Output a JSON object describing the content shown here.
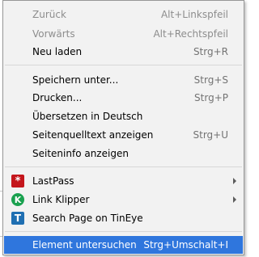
{
  "menu": {
    "back": {
      "label": "Zurück",
      "shortcut": "Alt+Linkspfeil"
    },
    "forward": {
      "label": "Vorwärts",
      "shortcut": "Alt+Rechtspfeil"
    },
    "reload": {
      "label": "Neu laden",
      "shortcut": "Strg+R"
    },
    "save_as": {
      "label": "Speichern unter...",
      "shortcut": "Strg+S"
    },
    "print": {
      "label": "Drucken...",
      "shortcut": "Strg+P"
    },
    "translate": {
      "label": "Übersetzen in Deutsch"
    },
    "view_source": {
      "label": "Seitenquelltext anzeigen",
      "shortcut": "Strg+U"
    },
    "page_info": {
      "label": "Seiteninfo anzeigen"
    },
    "lastpass": {
      "label": "LastPass",
      "icon_text": "*"
    },
    "link_klipper": {
      "label": "Link Klipper",
      "icon_text": "K"
    },
    "tineye": {
      "label": "Search Page on TinEye",
      "icon_text": "T"
    },
    "inspect": {
      "label": "Element untersuchen",
      "shortcut": "Strg+Umschalt+I"
    }
  },
  "colors": {
    "menu_background": "#f2f2f2",
    "selection": "#2f76dd",
    "lastpass_icon": "#c4161c",
    "link_klipper_icon": "#1aa14f",
    "tineye_icon": "#1f6fb2"
  }
}
